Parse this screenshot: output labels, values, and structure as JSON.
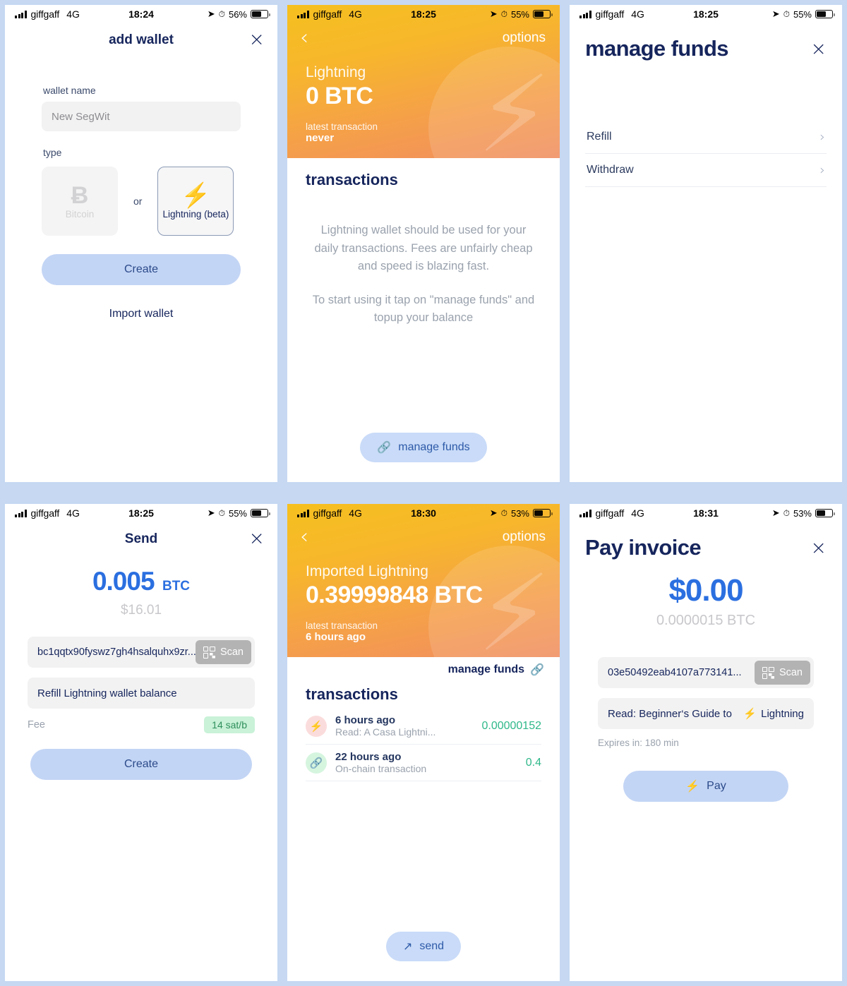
{
  "screens": [
    {
      "id": "add-wallet",
      "status": {
        "carrier": "giffgaff",
        "network": "4G",
        "time": "18:24",
        "battery": "56%"
      },
      "title": "add wallet",
      "close_icon": "×",
      "wallet_name_label": "wallet name",
      "wallet_name_placeholder": "New SegWit",
      "type_label": "type",
      "type_bitcoin": "Bitcoin",
      "type_bitcoin_glyph": "Ƀ",
      "or_label": "or",
      "type_lightning": "Lightning (beta)",
      "type_lightning_glyph": "⚡",
      "create_label": "Create",
      "import_label": "Import wallet"
    },
    {
      "id": "lightning-empty",
      "status": {
        "carrier": "giffgaff",
        "network": "4G",
        "time": "18:25",
        "battery": "55%"
      },
      "back_icon": "‹",
      "options_label": "options",
      "wallet_name": "Lightning",
      "balance": "0 BTC",
      "latest_label": "latest transaction",
      "latest_value": "never",
      "transactions_title": "transactions",
      "empty_p1": "Lightning wallet should be used for your daily transactions. Fees are unfairly cheap and speed is blazing fast.",
      "empty_p2": "To start using it tap on \"manage funds\" and topup your balance",
      "manage_funds_label": "manage funds"
    },
    {
      "id": "manage-funds",
      "status": {
        "carrier": "giffgaff",
        "network": "4G",
        "time": "18:25",
        "battery": "55%"
      },
      "title": "manage funds",
      "close_icon": "×",
      "items": [
        {
          "label": "Refill"
        },
        {
          "label": "Withdraw"
        }
      ]
    },
    {
      "id": "send",
      "status": {
        "carrier": "giffgaff",
        "network": "4G",
        "time": "18:25",
        "battery": "55%"
      },
      "title": "Send",
      "close_icon": "×",
      "amount": "0.005",
      "amount_unit": "BTC",
      "amount_fiat": "$16.01",
      "address": "bc1qqtx90fyswz7gh4hsalquhx9zr...",
      "scan_label": "Scan",
      "memo": "Refill Lightning wallet balance",
      "fee_label": "Fee",
      "fee_value": "14 sat/b",
      "create_label": "Create"
    },
    {
      "id": "imported-lightning",
      "status": {
        "carrier": "giffgaff",
        "network": "4G",
        "time": "18:30",
        "battery": "53%"
      },
      "back_icon": "‹",
      "options_label": "options",
      "wallet_name": "Imported Lightning",
      "balance": "0.39999848 BTC",
      "latest_label": "latest transaction",
      "latest_value": "6 hours ago",
      "manage_funds_label": "manage funds",
      "transactions_title": "transactions",
      "transactions": [
        {
          "when": "6 hours ago",
          "desc": "Read: A Casa Lightni...",
          "value": "0.00000152",
          "kind": "lightning"
        },
        {
          "when": "22 hours ago",
          "desc": "On-chain transaction",
          "value": "0.4",
          "kind": "onchain"
        }
      ],
      "send_label": "send"
    },
    {
      "id": "pay-invoice",
      "status": {
        "carrier": "giffgaff",
        "network": "4G",
        "time": "18:31",
        "battery": "53%"
      },
      "title": "Pay invoice",
      "close_icon": "×",
      "amount_fiat": "$0.00",
      "amount_btc": "0.0000015 BTC",
      "invoice": "03e50492eab4107a773141...",
      "scan_label": "Scan",
      "memo_prefix": "Read: Beginner‘s Guide to",
      "memo_suffix": "Lightning",
      "expires": "Expires in: 180 min",
      "pay_label": "Pay"
    }
  ],
  "colors": {
    "page_bg": "#c6d8f2",
    "navy": "#16255c",
    "blue": "#2b6fe0",
    "pill": "#c3d5f5",
    "gradient_from": "#f6c01f",
    "gradient_to": "#f18d60",
    "green": "#2fb88a",
    "fee_badge_bg": "#c9f2d8"
  }
}
